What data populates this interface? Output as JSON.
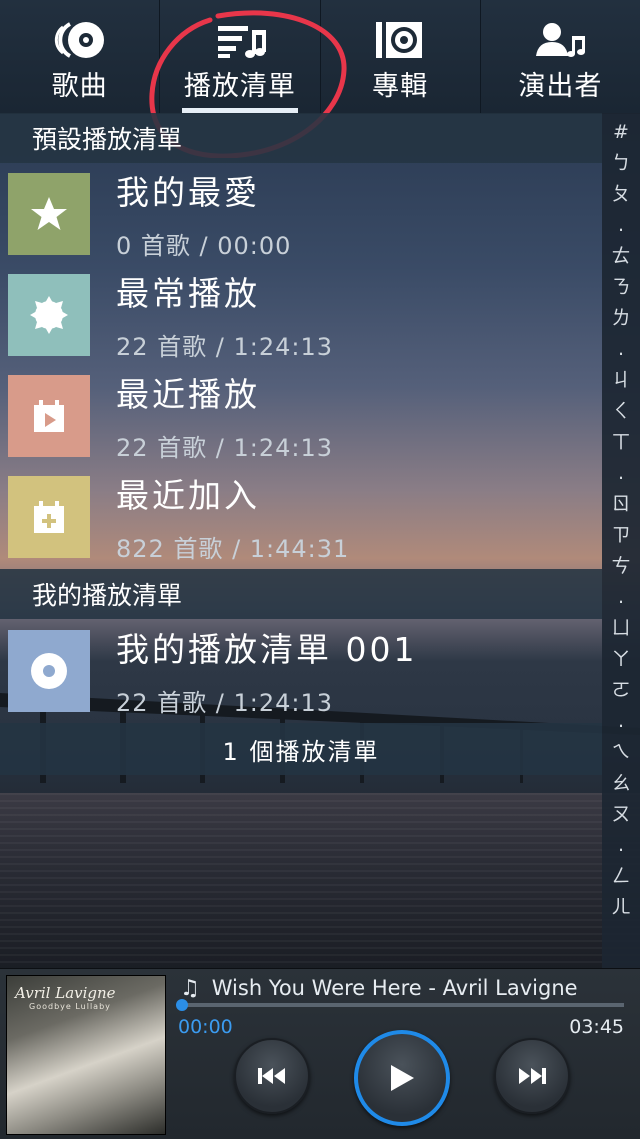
{
  "tabs": [
    {
      "label": "歌曲",
      "icon": "disc-icon",
      "active": false
    },
    {
      "label": "播放清單",
      "icon": "playlist-icon",
      "active": true
    },
    {
      "label": "專輯",
      "icon": "album-icon",
      "active": false
    },
    {
      "label": "演出者",
      "icon": "artist-icon",
      "active": false
    }
  ],
  "default_section": {
    "title": "預設播放清單"
  },
  "default_playlists": [
    {
      "title": "我的最愛",
      "sub": "0 首歌 / 00:00",
      "icon": "star-icon",
      "color": "#8fa36a"
    },
    {
      "title": "最常播放",
      "sub": "22 首歌 / 1:24:13",
      "icon": "badge-icon",
      "color": "#8fbfbb"
    },
    {
      "title": "最近播放",
      "sub": "22 首歌 / 1:24:13",
      "icon": "calendar-play-icon",
      "color": "#d89b8a"
    },
    {
      "title": "最近加入",
      "sub": "822 首歌 / 1:44:31",
      "icon": "calendar-add-icon",
      "color": "#d2c27e"
    }
  ],
  "my_section": {
    "title": "我的播放清單"
  },
  "my_playlists": [
    {
      "title": "我的播放清單 001",
      "sub": "22 首歌 / 1:24:13",
      "icon": "disc-icon",
      "color": "#8fa9cf"
    }
  ],
  "playlist_count": "1 個播放清單",
  "index_letters": [
    "#",
    "ㄅ",
    "ㄆ",
    ".",
    "ㄊ",
    "ㄋ",
    "ㄌ",
    ".",
    "ㄐ",
    "ㄑ",
    "ㄒ",
    ".",
    "ㄖ",
    "ㄗ",
    "ㄘ",
    ".",
    "ㄩ",
    "ㄚ",
    "ㄛ",
    ".",
    "ㄟ",
    "ㄠ",
    "ㄡ",
    ".",
    "ㄥ",
    "ㄦ"
  ],
  "player": {
    "song_title": "Wish You Were Here - Avril Lavigne",
    "elapsed": "00:00",
    "duration": "03:45",
    "progress": 0.0,
    "cover_title": "Avril Lavigne",
    "cover_subtitle": "Goodbye Lullaby"
  },
  "colors": {
    "accent": "#1f8ae8",
    "annotation": "#e8364a"
  }
}
